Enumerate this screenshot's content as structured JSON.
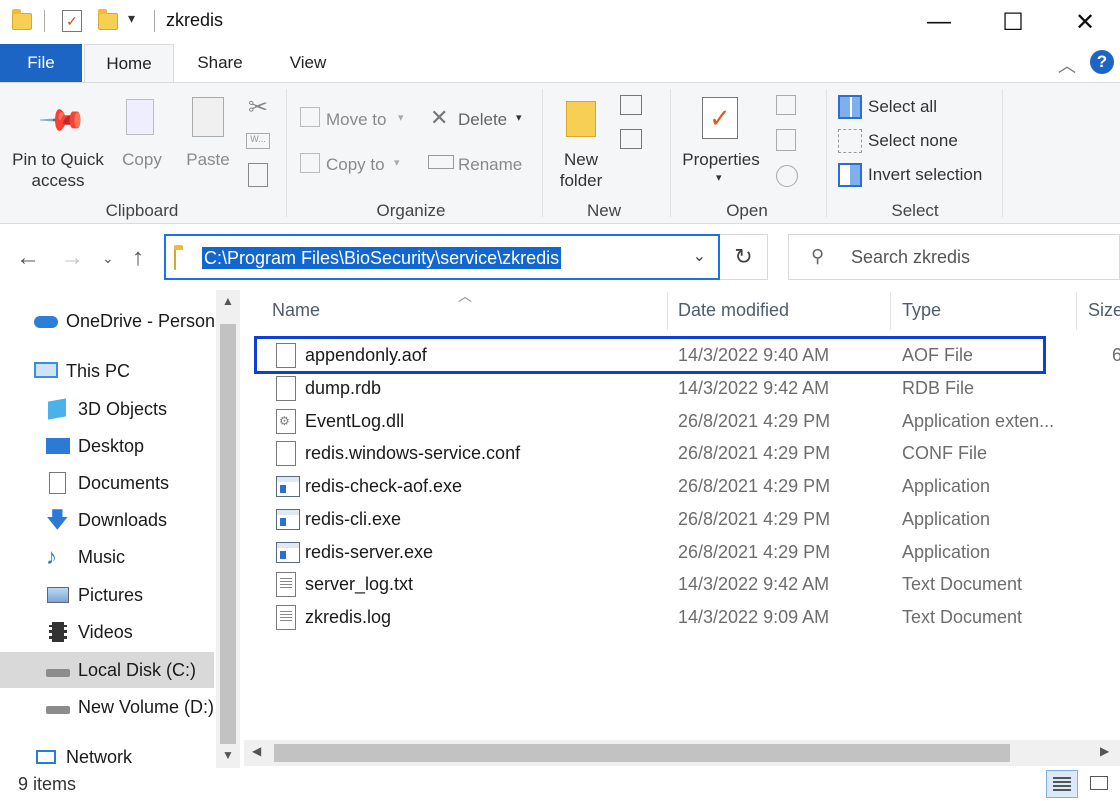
{
  "window": {
    "title": "zkredis",
    "controls": {
      "minimize": "—",
      "maximize": "☐",
      "close": "✕"
    }
  },
  "ribbon": {
    "tabs": [
      "File",
      "Home",
      "Share",
      "View"
    ],
    "clipboard": {
      "pin_label": "Pin to Quick access",
      "copy_label": "Copy",
      "paste_label": "Paste",
      "group_label": "Clipboard"
    },
    "organize": {
      "move_to": "Move to",
      "copy_to": "Copy to",
      "delete": "Delete",
      "rename": "Rename",
      "group_label": "Organize"
    },
    "new": {
      "new_folder": "New folder",
      "group_label": "New"
    },
    "open": {
      "properties": "Properties",
      "group_label": "Open"
    },
    "select": {
      "select_all": "Select all",
      "select_none": "Select none",
      "invert_selection": "Invert selection",
      "group_label": "Select"
    }
  },
  "address": {
    "path": "C:\\Program Files\\BioSecurity\\service\\zkredis",
    "search_placeholder": "Search zkredis"
  },
  "nav_pane": {
    "items": [
      {
        "label": "OneDrive - Person",
        "icon": "cloud-icon"
      },
      {
        "label": "This PC",
        "icon": "computer-icon"
      },
      {
        "label": "3D Objects",
        "icon": "cube-icon"
      },
      {
        "label": "Desktop",
        "icon": "desktop-icon"
      },
      {
        "label": "Documents",
        "icon": "document-icon"
      },
      {
        "label": "Downloads",
        "icon": "download-icon"
      },
      {
        "label": "Music",
        "icon": "music-icon"
      },
      {
        "label": "Pictures",
        "icon": "picture-icon"
      },
      {
        "label": "Videos",
        "icon": "video-icon"
      },
      {
        "label": "Local Disk (C:)",
        "icon": "drive-icon"
      },
      {
        "label": "New Volume (D:)",
        "icon": "drive-icon"
      },
      {
        "label": "Network",
        "icon": "network-icon"
      }
    ],
    "selected": "Local Disk (C:)"
  },
  "file_list": {
    "columns": [
      "Name",
      "Date modified",
      "Type",
      "Size"
    ],
    "rows": [
      {
        "name": "appendonly.aof",
        "date": "14/3/2022 9:40 AM",
        "type": "AOF File",
        "icon": "file-icon",
        "size_partial": "6"
      },
      {
        "name": "dump.rdb",
        "date": "14/3/2022 9:42 AM",
        "type": "RDB File",
        "icon": "file-icon"
      },
      {
        "name": "EventLog.dll",
        "date": "26/8/2021 4:29 PM",
        "type": "Application exten...",
        "icon": "dll-icon"
      },
      {
        "name": "redis.windows-service.conf",
        "date": "26/8/2021 4:29 PM",
        "type": "CONF File",
        "icon": "file-icon"
      },
      {
        "name": "redis-check-aof.exe",
        "date": "26/8/2021 4:29 PM",
        "type": "Application",
        "icon": "exe-icon"
      },
      {
        "name": "redis-cli.exe",
        "date": "26/8/2021 4:29 PM",
        "type": "Application",
        "icon": "exe-icon"
      },
      {
        "name": "redis-server.exe",
        "date": "26/8/2021 4:29 PM",
        "type": "Application",
        "icon": "exe-shield-icon"
      },
      {
        "name": "server_log.txt",
        "date": "14/3/2022 9:42 AM",
        "type": "Text Document",
        "icon": "text-file-icon"
      },
      {
        "name": "zkredis.log",
        "date": "14/3/2022 9:09 AM",
        "type": "Text Document",
        "icon": "text-file-icon"
      }
    ]
  },
  "status": {
    "item_count": "9 items"
  },
  "colors": {
    "accent": "#1c65c4",
    "highlight_box": "#0f3fd3",
    "address_selection": "#1167cf"
  }
}
